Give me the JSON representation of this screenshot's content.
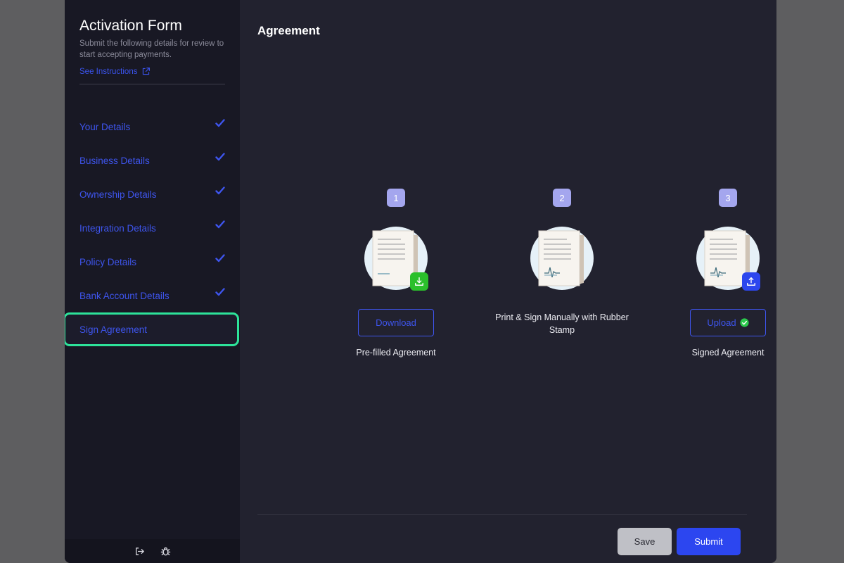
{
  "sidebar": {
    "title": "Activation Form",
    "subtitle": "Submit the following details for review to start accepting payments.",
    "instructions_link": "See Instructions",
    "items": [
      {
        "label": "Your Details",
        "completed": true
      },
      {
        "label": "Business Details",
        "completed": true
      },
      {
        "label": "Ownership Details",
        "completed": true
      },
      {
        "label": "Integration Details",
        "completed": true
      },
      {
        "label": "Policy Details",
        "completed": true
      },
      {
        "label": "Bank Account Details",
        "completed": true
      },
      {
        "label": "Sign Agreement",
        "completed": false,
        "active": true
      }
    ],
    "footer_icons": [
      "logout-icon",
      "bug-icon"
    ]
  },
  "main": {
    "title": "Agreement",
    "steps": [
      {
        "number": "1",
        "button_label": "Download",
        "caption": "Pre-filled Agreement",
        "corner_icon": "download-icon",
        "corner_color": "#2bc02b"
      },
      {
        "number": "2",
        "caption": "Print & Sign Manually with Rubber Stamp"
      },
      {
        "number": "3",
        "button_label": "Upload",
        "caption": "Signed Agreement",
        "corner_icon": "upload-icon",
        "corner_color": "#2d47ee",
        "status_icon": "check-circle-icon",
        "status_color": "#2bc94c"
      }
    ]
  },
  "footer": {
    "save_label": "Save",
    "submit_label": "Submit"
  },
  "colors": {
    "accent": "#3e55ee",
    "active_outline": "#2de39a",
    "badge": "#a4a6ee",
    "submit": "#2c46f0"
  }
}
